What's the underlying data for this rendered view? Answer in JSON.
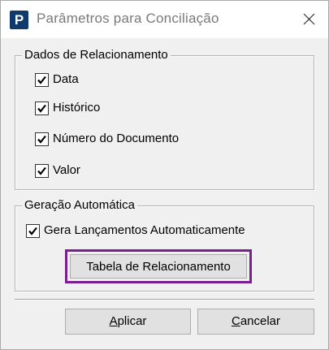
{
  "window": {
    "app_icon_letter": "P",
    "title": "Parâmetros para Conciliação"
  },
  "relacionamento": {
    "legend": "Dados de Relacionamento",
    "items": [
      {
        "label": "Data",
        "checked": true
      },
      {
        "label": "Histórico",
        "checked": true
      },
      {
        "label": "Número do Documento",
        "checked": true
      },
      {
        "label": "Valor",
        "checked": true
      }
    ]
  },
  "geracao": {
    "legend": "Geração Automática",
    "auto_label": "Gera Lançamentos Automaticamente",
    "auto_checked": true,
    "table_button": "Tabela de Relacionamento"
  },
  "footer": {
    "apply_first": "A",
    "apply_rest": "plicar",
    "cancel_first": "C",
    "cancel_rest": "ancelar"
  },
  "colors": {
    "highlight_border": "#7a1f8f",
    "app_icon_bg": "#0f3a6b"
  },
  "icons": [
    "app-logo-icon",
    "close-icon",
    "checkmark-icon"
  ]
}
